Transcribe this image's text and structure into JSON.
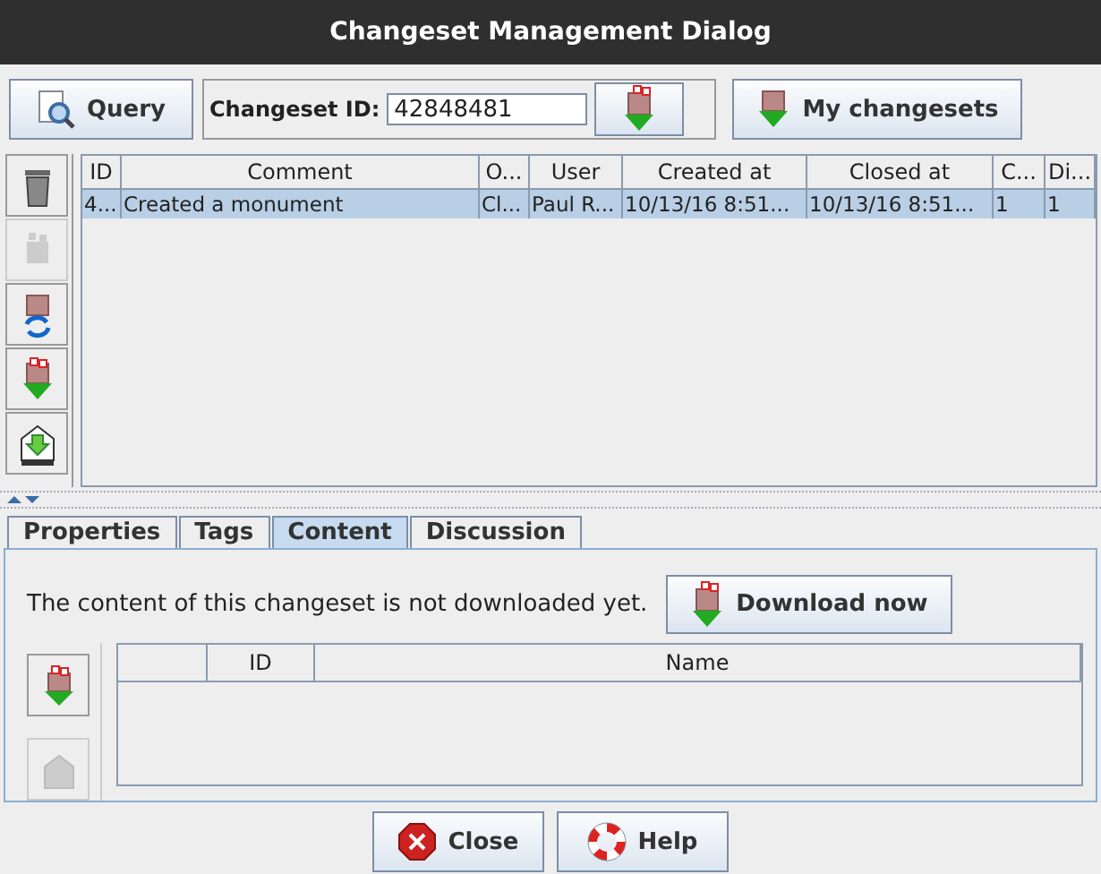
{
  "window": {
    "title": "Changeset Management Dialog"
  },
  "query_button": {
    "label": "Query"
  },
  "changeset_id": {
    "label": "Changeset ID:",
    "value": "42848481"
  },
  "my_changesets_button": {
    "label": "My changesets"
  },
  "side_toolbar": [
    {
      "kind": "trash",
      "disabled": false
    },
    {
      "kind": "box",
      "disabled": true
    },
    {
      "kind": "refresh",
      "disabled": false
    },
    {
      "kind": "download",
      "disabled": false
    },
    {
      "kind": "upload",
      "disabled": false
    }
  ],
  "table": {
    "columns": [
      "ID",
      "Comment",
      "O...",
      "User",
      "Created at",
      "Closed at",
      "C...",
      "Di..."
    ],
    "rows": [
      {
        "selected": true,
        "cells": [
          "4...",
          "Created a monument",
          "Cl...",
          "Paul R...",
          "10/13/16 8:51...",
          "10/13/16 8:51...",
          "1",
          "1"
        ]
      }
    ]
  },
  "tabs": [
    {
      "label": "Properties",
      "selected": false
    },
    {
      "label": "Tags",
      "selected": false
    },
    {
      "label": "Content",
      "selected": true
    },
    {
      "label": "Discussion",
      "selected": false
    }
  ],
  "content": {
    "message": "The content of this changeset is not downloaded yet.",
    "download_button": "Download now",
    "toolbar": [
      {
        "kind": "download",
        "disabled": false
      },
      {
        "kind": "box",
        "disabled": true
      }
    ],
    "columns": [
      "",
      "ID",
      "Name"
    ]
  },
  "buttons": [
    {
      "kind": "close",
      "label": "Close"
    },
    {
      "kind": "help",
      "label": "Help"
    }
  ]
}
